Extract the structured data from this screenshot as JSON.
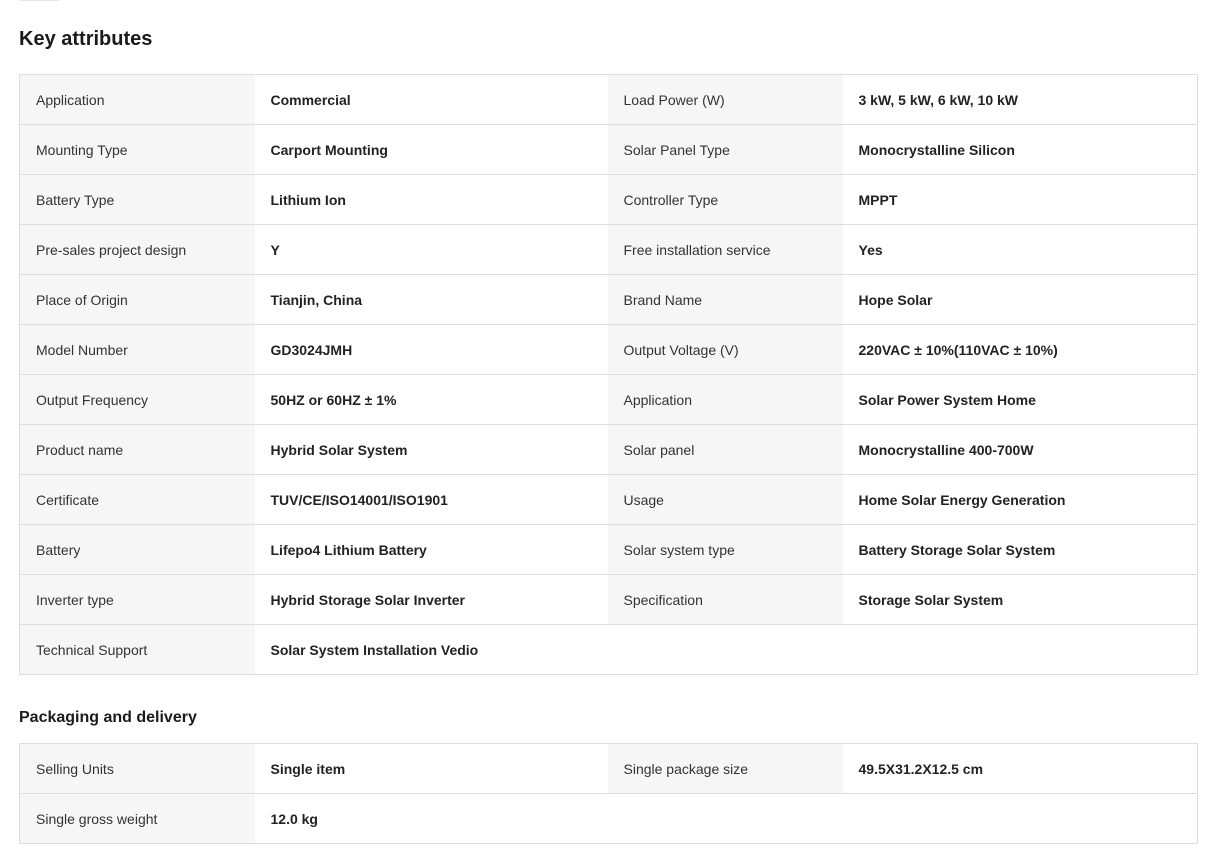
{
  "key_attributes": {
    "title": "Key attributes",
    "rows": [
      [
        {
          "label": "Application",
          "value": "Commercial"
        },
        {
          "label": "Load Power (W)",
          "value": "3 kW, 5 kW, 6 kW, 10 kW"
        }
      ],
      [
        {
          "label": "Mounting Type",
          "value": "Carport Mounting"
        },
        {
          "label": "Solar Panel Type",
          "value": "Monocrystalline Silicon"
        }
      ],
      [
        {
          "label": "Battery Type",
          "value": "Lithium Ion"
        },
        {
          "label": "Controller Type",
          "value": "MPPT"
        }
      ],
      [
        {
          "label": "Pre-sales project design",
          "value": "Y"
        },
        {
          "label": "Free installation service",
          "value": "Yes"
        }
      ],
      [
        {
          "label": "Place of Origin",
          "value": "Tianjin, China"
        },
        {
          "label": "Brand Name",
          "value": "Hope Solar"
        }
      ],
      [
        {
          "label": "Model Number",
          "value": "GD3024JMH"
        },
        {
          "label": "Output Voltage (V)",
          "value": "220VAC ± 10%(110VAC ± 10%)"
        }
      ],
      [
        {
          "label": "Output Frequency",
          "value": "50HZ or 60HZ ± 1%"
        },
        {
          "label": "Application",
          "value": "Solar Power System Home"
        }
      ],
      [
        {
          "label": "Product name",
          "value": "Hybrid Solar System"
        },
        {
          "label": "Solar panel",
          "value": "Monocrystalline 400-700W"
        }
      ],
      [
        {
          "label": "Certificate",
          "value": "TUV/CE/ISO14001/ISO1901"
        },
        {
          "label": "Usage",
          "value": "Home Solar Energy Generation"
        }
      ],
      [
        {
          "label": "Battery",
          "value": "Lifepo4 Lithium Battery"
        },
        {
          "label": "Solar system type",
          "value": "Battery Storage Solar System"
        }
      ],
      [
        {
          "label": "Inverter type",
          "value": "Hybrid Storage Solar Inverter"
        },
        {
          "label": "Specification",
          "value": "Storage Solar System"
        }
      ],
      [
        {
          "label": "Technical Support",
          "value": "Solar System Installation Vedio"
        },
        null
      ]
    ]
  },
  "packaging": {
    "title": "Packaging and delivery",
    "rows": [
      [
        {
          "label": "Selling Units",
          "value": "Single item"
        },
        {
          "label": "Single package size",
          "value": "49.5X31.2X12.5 cm"
        }
      ],
      [
        {
          "label": "Single gross weight",
          "value": "12.0 kg"
        },
        null
      ]
    ]
  }
}
